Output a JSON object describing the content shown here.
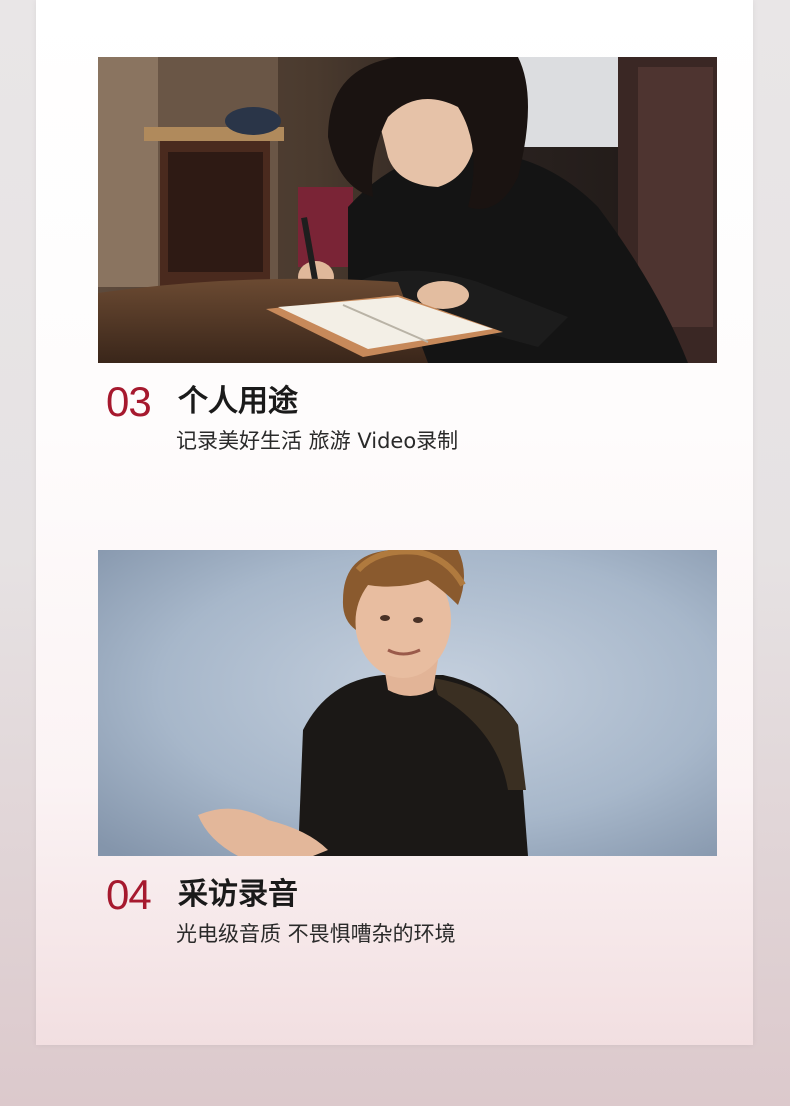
{
  "sections": [
    {
      "number": "03",
      "title": "个人用途",
      "description": "记录美好生活 旅游 Video录制"
    },
    {
      "number": "04",
      "title": "采访录音",
      "description": "光电级音质 不畏惧嘈杂的环境"
    }
  ],
  "colors": {
    "accent": "#a6192e",
    "title": "#1a1a1a",
    "text": "#2a2a2a"
  }
}
